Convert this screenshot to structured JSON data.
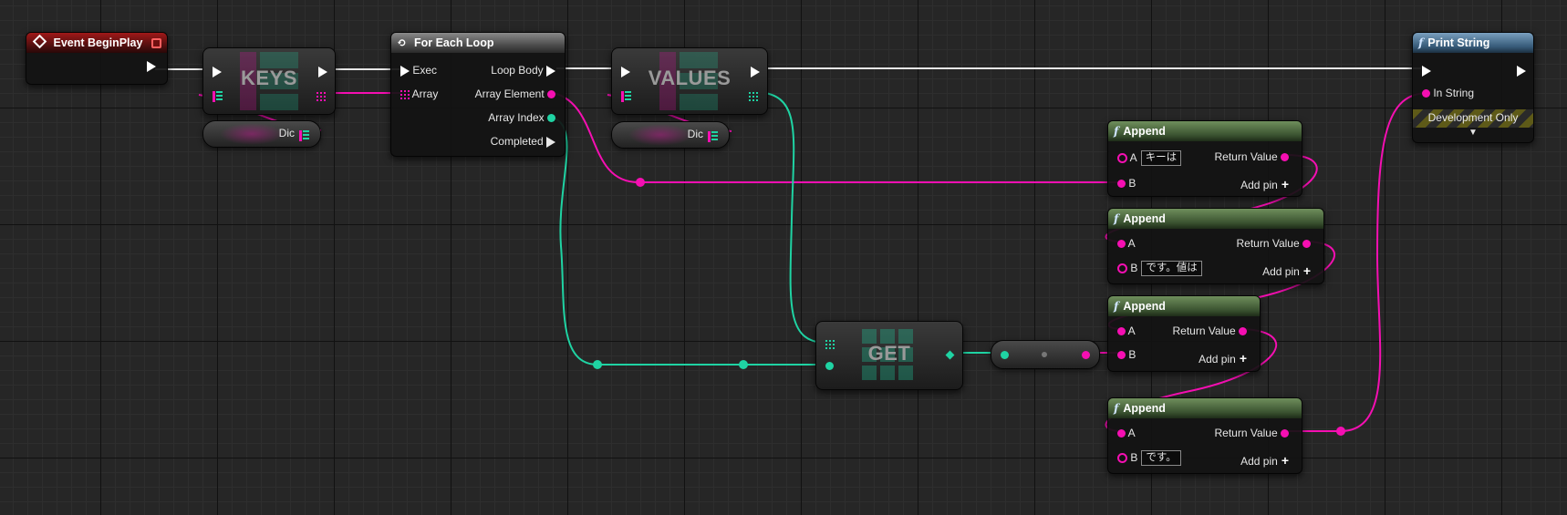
{
  "nodes": {
    "event_begin_play": {
      "title": "Event BeginPlay"
    },
    "keys": {
      "title": "KEYS"
    },
    "keys_dic": {
      "label": "Dic"
    },
    "for_each": {
      "title": "For Each Loop",
      "exec": "Exec",
      "array": "Array",
      "loop_body": "Loop Body",
      "array_element": "Array Element",
      "array_index": "Array Index",
      "completed": "Completed"
    },
    "values": {
      "title": "VALUES"
    },
    "values_dic": {
      "label": "Dic"
    },
    "get": {
      "title": "GET"
    },
    "append1": {
      "title": "Append",
      "a": "A",
      "a_value": "キーは",
      "b": "B",
      "return": "Return Value",
      "add_pin": "Add pin"
    },
    "append2": {
      "title": "Append",
      "a": "A",
      "b": "B",
      "b_value": "です。値は",
      "return": "Return Value",
      "add_pin": "Add pin"
    },
    "append3": {
      "title": "Append",
      "a": "A",
      "b": "B",
      "return": "Return Value",
      "add_pin": "Add pin"
    },
    "append4": {
      "title": "Append",
      "a": "A",
      "b": "B",
      "b_value": "です。",
      "return": "Return Value",
      "add_pin": "Add pin"
    },
    "print_string": {
      "title": "Print String",
      "in_string": "In String",
      "dev_only": "Development Only"
    }
  },
  "colors": {
    "exec": "#ffffff",
    "string": "#f50fb2",
    "integer": "#1fd3a3",
    "event_header": "#a01818",
    "function_header": "#6f8f5c",
    "print_header": "#7aa0bf"
  },
  "icons": {
    "event": "diamond-icon",
    "loop": "loop-icon",
    "function": "function-f-icon",
    "stop": "square-icon"
  }
}
